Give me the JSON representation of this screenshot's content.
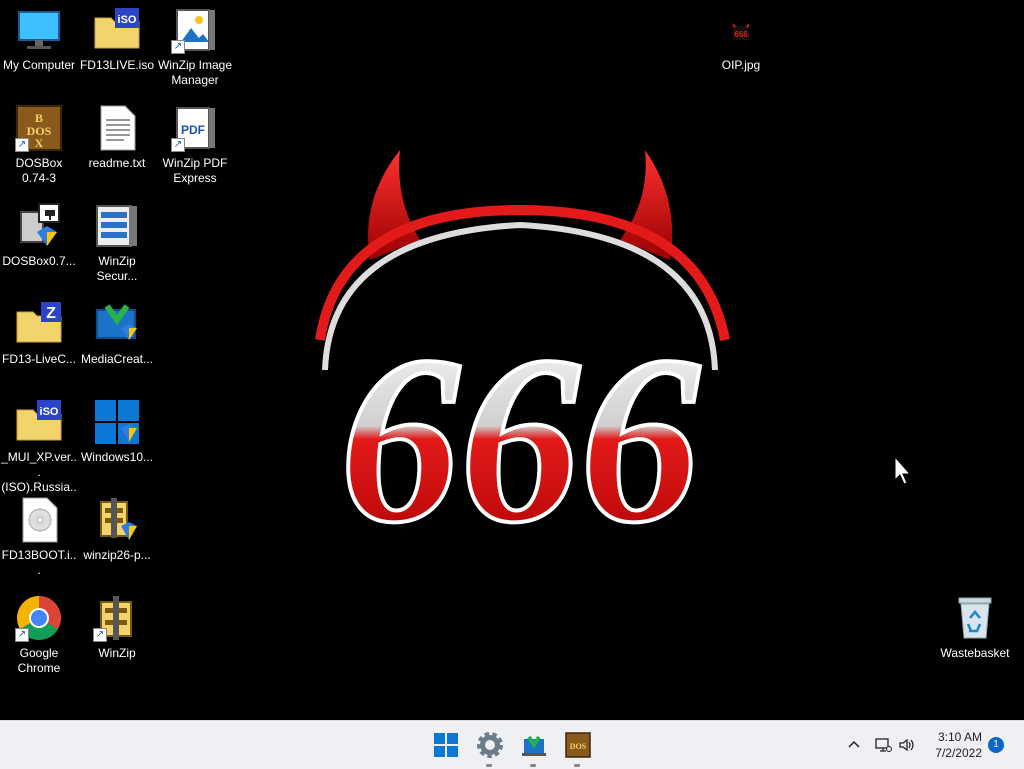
{
  "desktop_icons": [
    {
      "label": "My Computer",
      "icon": "monitor-icon"
    },
    {
      "label": "FD13LIVE.iso",
      "icon": "iso-folder-icon"
    },
    {
      "label": "WinZip Image Manager",
      "icon": "winzip-image-icon"
    },
    {
      "label": "DOSBox 0.74-3",
      "icon": "dosbox-icon"
    },
    {
      "label": "readme.txt",
      "icon": "text-file-icon"
    },
    {
      "label": "WinZip PDF Express",
      "icon": "winzip-pdf-icon"
    },
    {
      "label": "DOSBox0.7...",
      "icon": "installer-icon"
    },
    {
      "label": "WinZip Secur...",
      "icon": "winzip-secure-icon"
    },
    {
      "label": "FD13-LiveC...",
      "icon": "zip-folder-icon"
    },
    {
      "label": "MediaCreat...",
      "icon": "media-creation-icon"
    },
    {
      "label": "_MUI_XP.ver... (ISO).Russia...",
      "icon": "iso-folder-icon"
    },
    {
      "label": "Windows10...",
      "icon": "windows-installer-icon"
    },
    {
      "label": "FD13BOOT.i...",
      "icon": "disc-image-icon"
    },
    {
      "label": "winzip26-p...",
      "icon": "winzip-setup-icon"
    },
    {
      "label": "Google Chrome",
      "icon": "chrome-icon"
    },
    {
      "label": "WinZip",
      "icon": "winzip-icon"
    },
    {
      "label": "OIP.jpg",
      "icon": "image-file-icon"
    },
    {
      "label": "Wastebasket",
      "icon": "recycle-bin-icon"
    }
  ],
  "wallpaper": {
    "text": "666",
    "colors": {
      "accent": "#e21a1a",
      "background": "#000000"
    }
  },
  "taskbar": {
    "apps": [
      {
        "name": "start",
        "icon": "windows-start-icon"
      },
      {
        "name": "settings",
        "icon": "gear-icon"
      },
      {
        "name": "app",
        "icon": "app-icon"
      },
      {
        "name": "dosbox",
        "icon": "dosbox-icon"
      }
    ],
    "clock": {
      "time": "3:10 AM",
      "date": "7/2/2022"
    },
    "notification_count": "1"
  }
}
